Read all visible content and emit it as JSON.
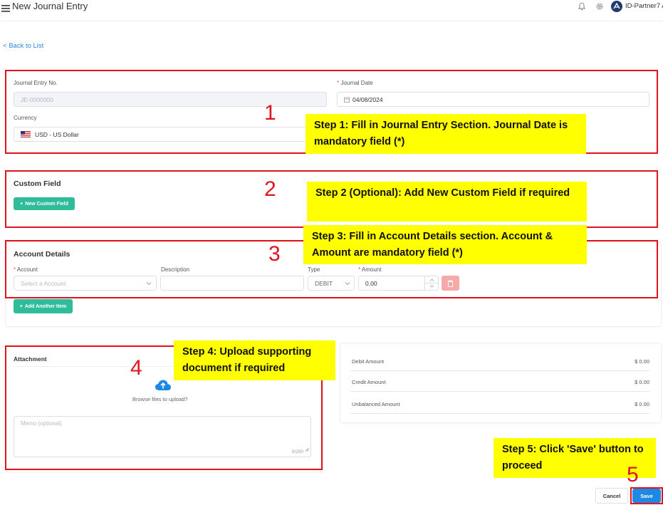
{
  "header": {
    "title": "New Journal Entry",
    "user_name": "ID-Partner7 A."
  },
  "nav": {
    "back_label": "Back to List"
  },
  "journal": {
    "entry_no_label": "Journal Entry No.",
    "entry_no_value": "JE-0000000",
    "date_label": "Journal Date",
    "date_value": "04/08/2024",
    "currency_label": "Currency",
    "currency_value": "USD - US Dollar"
  },
  "custom_field": {
    "title": "Custom Field",
    "add_button": "New Custom Field"
  },
  "account_details": {
    "title": "Account Details",
    "account_label": "Account",
    "account_placeholder": "Select a Account",
    "description_label": "Description",
    "type_label": "Type",
    "type_value": "DEBIT",
    "amount_label": "Amount",
    "amount_value": "0.00",
    "add_item_button": "Add Another Item"
  },
  "attachment": {
    "title": "Attachment",
    "browse_text": "Browse files to upload?",
    "memo_placeholder": "Memo (optional)",
    "memo_counter": "0/250"
  },
  "summary": {
    "rows": [
      {
        "label": "Debit Amount",
        "value": "$ 0.00"
      },
      {
        "label": "Credit Amount",
        "value": "$ 0.00"
      },
      {
        "label": "Unbalanced Amount",
        "value": "$ 0.00"
      }
    ]
  },
  "footer": {
    "cancel_label": "Cancel",
    "save_label": "Save"
  },
  "annotations": {
    "num1": "1",
    "num2": "2",
    "num3": "3",
    "num4": "4",
    "num5": "5",
    "step1": "Step 1: Fill in Journal Entry Section. Journal Date is mandatory field (*)",
    "step2": "Step 2 (Optional): Add New Custom Field if required",
    "step3": "Step 3: Fill in Account Details section. Account & Amount are mandatory field (*)",
    "step4": "Step 4: Upload supporting document if required",
    "step5": "Step 5: Click 'Save' button to proceed"
  },
  "colors": {
    "highlight_red": "#e0141e",
    "callout_yellow": "#ffff00",
    "accent_green": "#2fbc9b",
    "primary_blue": "#1e88e5"
  }
}
